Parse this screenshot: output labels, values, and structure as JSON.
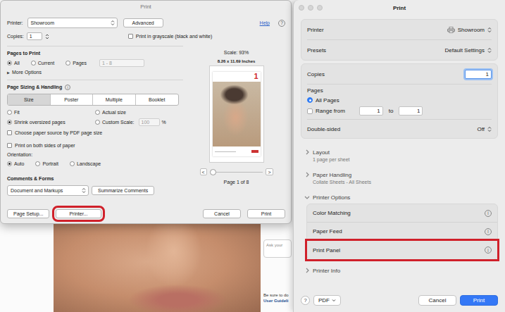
{
  "background_document": {
    "ask_placeholder": "Ask your",
    "note": "Be sure to do",
    "link": "User Guideli"
  },
  "acrobat_dialog": {
    "title": "Print",
    "printer": {
      "label": "Printer:",
      "value": "Showroom"
    },
    "advanced_button": "Advanced",
    "help_link": "Help",
    "help_icon": "?",
    "copies": {
      "label": "Copies:",
      "value": "1"
    },
    "grayscale": {
      "label": "Print in grayscale (black and white)",
      "checked": false
    },
    "pages_to_print": {
      "title": "Pages to Print",
      "options": [
        {
          "label": "All",
          "selected": true
        },
        {
          "label": "Current",
          "selected": false
        },
        {
          "label": "Pages",
          "selected": false
        }
      ],
      "range_field": {
        "value": "1 - 8",
        "disabled": true
      },
      "more_options": {
        "icon": "▶",
        "label": "More Options",
        "expanded": false
      }
    },
    "page_sizing": {
      "title": "Page Sizing & Handling",
      "info_icon": "i",
      "modes": [
        {
          "label": "Size",
          "selected": true
        },
        {
          "label": "Poster",
          "selected": false
        },
        {
          "label": "Multiple",
          "selected": false
        },
        {
          "label": "Booklet",
          "selected": false
        }
      ],
      "options": [
        {
          "label": "Fit",
          "selected": false,
          "kind": "plain",
          "field": "",
          "unit": "",
          "disabled": false
        },
        {
          "label": "Actual size",
          "selected": false,
          "kind": "plain",
          "field": "",
          "unit": "",
          "disabled": false
        },
        {
          "label": "Shrink oversized pages",
          "selected": true,
          "kind": "plain",
          "field": "",
          "unit": "",
          "disabled": false
        },
        {
          "label": "Custom Scale:",
          "selected": false,
          "kind": "scale",
          "field": "100",
          "unit": "%",
          "disabled": true
        }
      ],
      "paper_source": {
        "label": "Choose paper source by PDF page size",
        "checked": false
      }
    },
    "both_sides": {
      "label": "Print on both sides of paper",
      "checked": false
    },
    "orientation": {
      "label": "Orientation:",
      "options": [
        {
          "label": "Auto",
          "selected": true
        },
        {
          "label": "Portrait",
          "selected": false
        },
        {
          "label": "Landscape",
          "selected": false
        }
      ]
    },
    "comments_forms": {
      "title": "Comments & Forms",
      "value": "Document and Markups",
      "summarize_button": "Summarize Comments"
    },
    "preview": {
      "scale": "Scale: 93%",
      "paper_size": "8.26 x 11.69 Inches",
      "page_number": "1",
      "prev_button": "<",
      "next_button": ">",
      "slider_level": 0,
      "page_label": "Page 1 of 8"
    },
    "footer_buttons": [
      {
        "label": "Page Setup...",
        "highlighted": false
      },
      {
        "label": "Printer...",
        "highlighted": true
      }
    ],
    "action_buttons": [
      {
        "label": "Cancel"
      },
      {
        "label": "Print"
      }
    ]
  },
  "mac_dialog": {
    "title": "Print",
    "settings": [
      {
        "label": "Printer",
        "value": "Showroom",
        "kind": "printer"
      },
      {
        "label": "Presets",
        "value": "Default Settings",
        "kind": "popup"
      }
    ],
    "copies": {
      "label": "Copies",
      "value": "1",
      "focused": true
    },
    "pages": {
      "label": "Pages",
      "all_pages": {
        "label": "All Pages",
        "selected": true
      },
      "range": {
        "label": "Range from",
        "checked": false,
        "from": "1",
        "to_label": "to",
        "to": "1"
      }
    },
    "double_sided": {
      "label": "Double-sided",
      "value": "Off"
    },
    "sections": [
      {
        "title": "Layout",
        "summary": "1 page per sheet",
        "expanded": false,
        "items": []
      },
      {
        "title": "Paper Handling",
        "summary": "Collate Sheets - All Sheets",
        "expanded": false,
        "items": []
      },
      {
        "title": "Printer Options",
        "summary": "",
        "expanded": true,
        "items": [
          {
            "label": "Color Matching",
            "info_icon": "i",
            "highlighted": false
          },
          {
            "label": "Paper Feed",
            "info_icon": "i",
            "highlighted": false
          },
          {
            "label": "Print Panel",
            "info_icon": "i",
            "highlighted": true
          }
        ]
      },
      {
        "title": "Printer Info",
        "summary": "",
        "expanded": false,
        "items": []
      }
    ],
    "footer": {
      "help_icon": "?",
      "pdf_button": "PDF",
      "cancel_button": "Cancel",
      "print_button": "Print"
    }
  }
}
